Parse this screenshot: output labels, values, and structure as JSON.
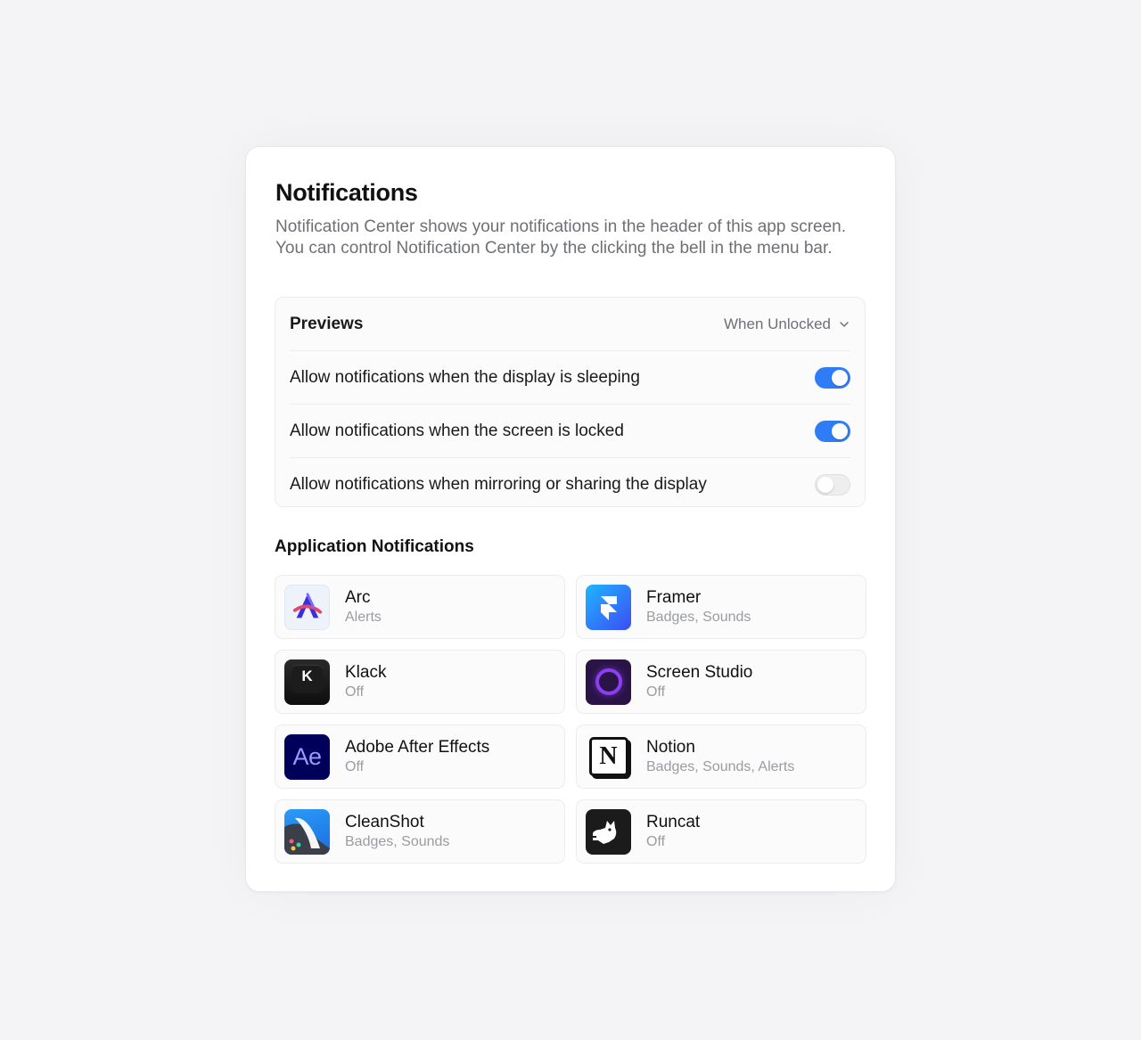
{
  "header": {
    "title": "Notifications",
    "description_line1": "Notification Center shows your notifications in the header of this app screen.",
    "description_line2": "You can control Notification Center by the clicking the bell in the menu bar."
  },
  "previews": {
    "label": "Previews",
    "selected": "When Unlocked"
  },
  "toggles": [
    {
      "label": "Allow notifications when the display is sleeping",
      "on": true
    },
    {
      "label": "Allow notifications when the screen is locked",
      "on": true
    },
    {
      "label": "Allow notifications when mirroring or sharing the display",
      "on": false
    }
  ],
  "apps_title": "Application Notifications",
  "apps": [
    {
      "name": "Arc",
      "status": "Alerts",
      "icon": "arc-icon"
    },
    {
      "name": "Framer",
      "status": "Badges, Sounds",
      "icon": "framer-icon"
    },
    {
      "name": "Klack",
      "status": "Off",
      "icon": "klack-icon",
      "icon_text": "K"
    },
    {
      "name": "Screen Studio",
      "status": "Off",
      "icon": "screen-studio-icon"
    },
    {
      "name": "Adobe After Effects",
      "status": "Off",
      "icon": "after-effects-icon",
      "icon_text": "Ae"
    },
    {
      "name": "Notion",
      "status": "Badges, Sounds, Alerts",
      "icon": "notion-icon",
      "icon_text": "N"
    },
    {
      "name": "CleanShot",
      "status": "Badges, Sounds",
      "icon": "cleanshot-icon"
    },
    {
      "name": "Runcat",
      "status": "Off",
      "icon": "runcat-icon"
    }
  ],
  "colors": {
    "accent": "#2f7df6",
    "background": "#f4f4f6",
    "card": "#ffffff"
  }
}
